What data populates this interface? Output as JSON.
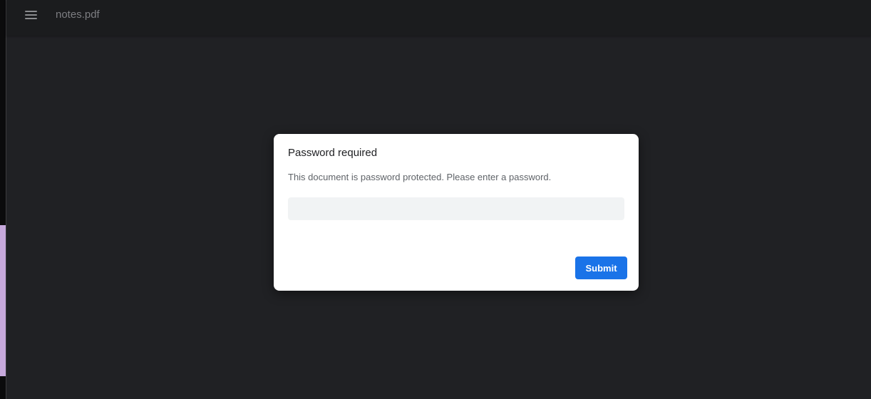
{
  "toolbar": {
    "menu_icon": "hamburger-menu-icon",
    "title": "notes.pdf"
  },
  "dialog": {
    "title": "Password required",
    "message": "This document is password protected. Please enter a password.",
    "password_value": "",
    "submit_label": "Submit"
  },
  "colors": {
    "accent": "#1a73e8",
    "viewer_background": "#202124",
    "toolbar_background": "#1b1c1e"
  }
}
